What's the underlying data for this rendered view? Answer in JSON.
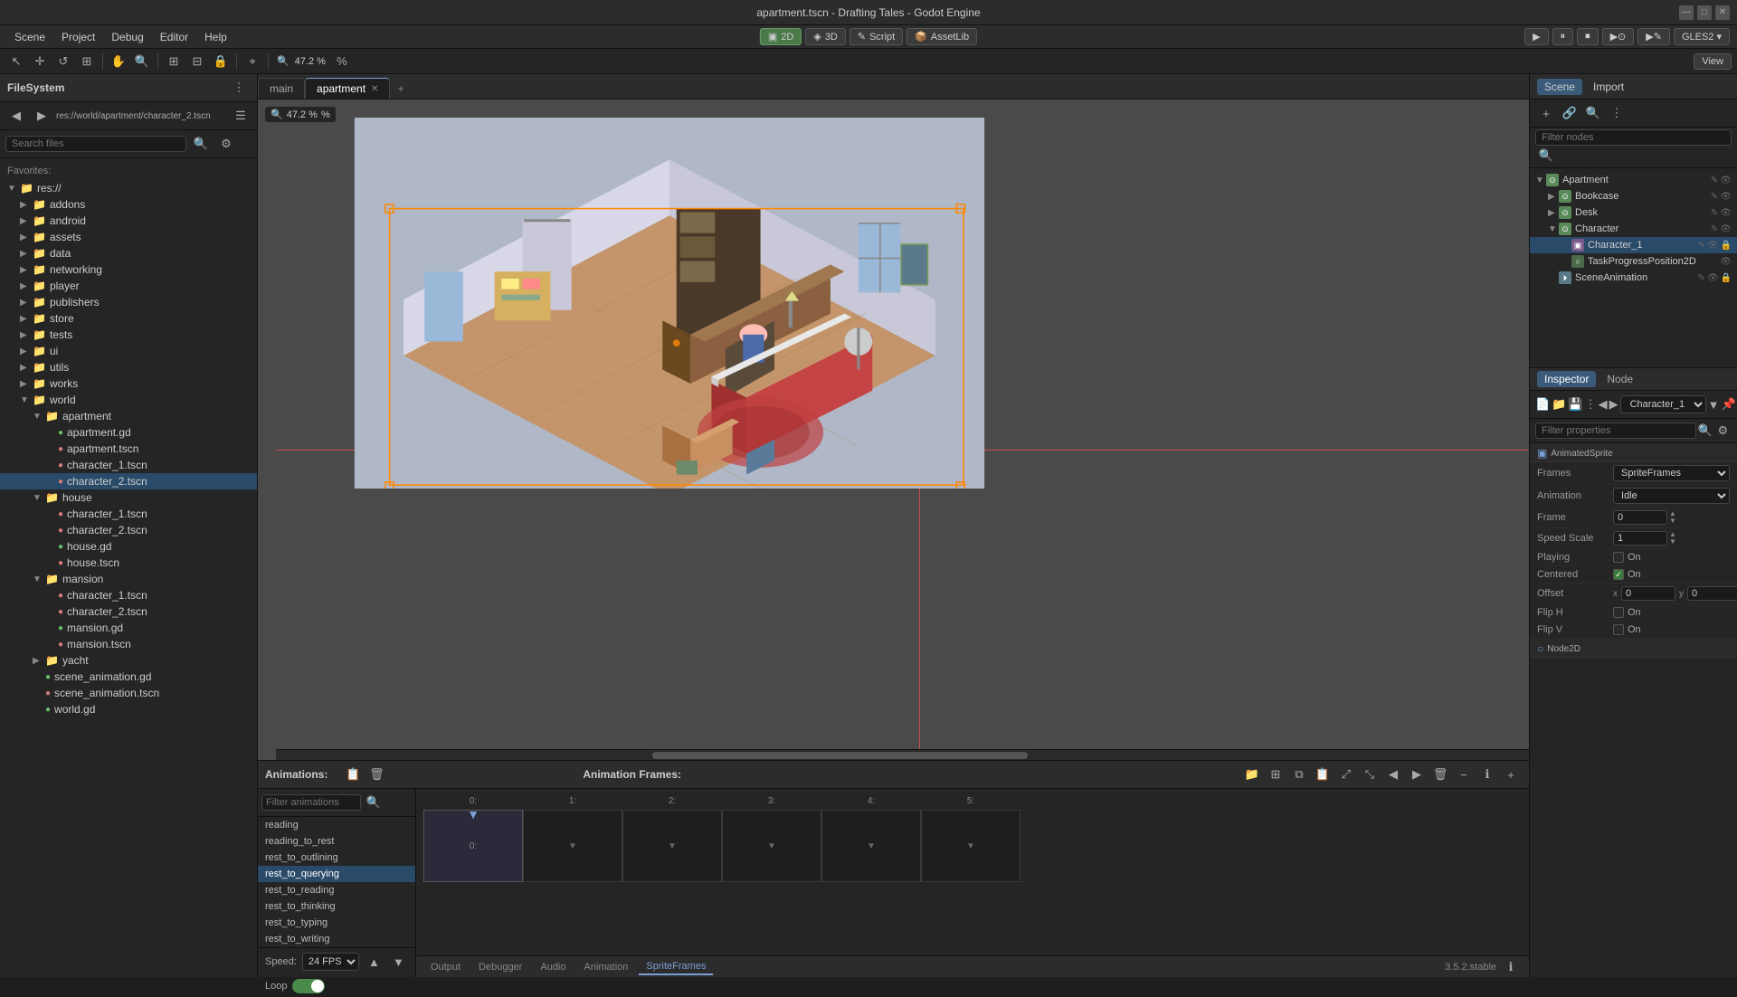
{
  "titlebar": {
    "title": "apartment.tscn - Drafting Tales - Godot Engine",
    "minimize": "—",
    "maximize": "□",
    "close": "✕"
  },
  "menubar": {
    "items": [
      "Scene",
      "Project",
      "Debug",
      "Editor",
      "Help"
    ],
    "toolbar": {
      "btn2d": "2D",
      "btn3d": "3D",
      "btnScript": "Script",
      "btnAssetLib": "AssetLib"
    },
    "gles": "GLES2 ▾"
  },
  "toolbar2": {
    "zoom": "47.2 %",
    "view": "View"
  },
  "filesystem": {
    "title": "FileSystem",
    "search_placeholder": "Search files",
    "favorites": "Favorites:",
    "tree": [
      {
        "indent": 0,
        "type": "dir",
        "label": "res://",
        "expanded": true
      },
      {
        "indent": 1,
        "type": "dir",
        "label": "addons",
        "expanded": false
      },
      {
        "indent": 1,
        "type": "dir",
        "label": "android",
        "expanded": false
      },
      {
        "indent": 1,
        "type": "dir",
        "label": "assets",
        "expanded": false
      },
      {
        "indent": 1,
        "type": "dir",
        "label": "data",
        "expanded": false
      },
      {
        "indent": 1,
        "type": "dir",
        "label": "networking",
        "expanded": false
      },
      {
        "indent": 1,
        "type": "dir",
        "label": "player",
        "expanded": false
      },
      {
        "indent": 1,
        "type": "dir",
        "label": "publishers",
        "expanded": false
      },
      {
        "indent": 1,
        "type": "dir",
        "label": "store",
        "expanded": false
      },
      {
        "indent": 1,
        "type": "dir",
        "label": "tests",
        "expanded": false
      },
      {
        "indent": 1,
        "type": "dir",
        "label": "ui",
        "expanded": false
      },
      {
        "indent": 1,
        "type": "dir",
        "label": "utils",
        "expanded": false
      },
      {
        "indent": 1,
        "type": "dir",
        "label": "works",
        "expanded": false
      },
      {
        "indent": 1,
        "type": "dir",
        "label": "world",
        "expanded": true
      },
      {
        "indent": 2,
        "type": "dir",
        "label": "apartment",
        "expanded": true
      },
      {
        "indent": 3,
        "type": "file",
        "ext": "gd",
        "label": "apartment.gd"
      },
      {
        "indent": 3,
        "type": "file",
        "ext": "tscn",
        "label": "apartment.tscn"
      },
      {
        "indent": 3,
        "type": "file",
        "ext": "tscn",
        "label": "character_1.tscn"
      },
      {
        "indent": 3,
        "type": "file",
        "ext": "tscn",
        "label": "character_2.tscn",
        "selected": true
      },
      {
        "indent": 2,
        "type": "dir",
        "label": "house",
        "expanded": true
      },
      {
        "indent": 3,
        "type": "file",
        "ext": "tscn",
        "label": "character_1.tscn"
      },
      {
        "indent": 3,
        "type": "file",
        "ext": "tscn",
        "label": "character_2.tscn"
      },
      {
        "indent": 3,
        "type": "file",
        "ext": "gd",
        "label": "house.gd"
      },
      {
        "indent": 3,
        "type": "file",
        "ext": "tscn",
        "label": "house.tscn"
      },
      {
        "indent": 2,
        "type": "dir",
        "label": "mansion",
        "expanded": true
      },
      {
        "indent": 3,
        "type": "file",
        "ext": "tscn",
        "label": "character_1.tscn"
      },
      {
        "indent": 3,
        "type": "file",
        "ext": "tscn",
        "label": "character_2.tscn"
      },
      {
        "indent": 3,
        "type": "file",
        "ext": "gd",
        "label": "mansion.gd"
      },
      {
        "indent": 3,
        "type": "file",
        "ext": "tscn",
        "label": "mansion.tscn"
      },
      {
        "indent": 2,
        "type": "dir",
        "label": "yacht",
        "expanded": false
      },
      {
        "indent": 2,
        "type": "file",
        "ext": "gd",
        "label": "scene_animation.gd"
      },
      {
        "indent": 2,
        "type": "file",
        "ext": "tscn",
        "label": "scene_animation.tscn"
      },
      {
        "indent": 2,
        "type": "file",
        "ext": "gd",
        "label": "world.gd"
      }
    ]
  },
  "tabs": {
    "items": [
      "main",
      "apartment"
    ],
    "active": "apartment",
    "add": "+"
  },
  "viewport": {
    "zoom": "47.2 %"
  },
  "scene_panel": {
    "tabs": [
      "Scene",
      "Import"
    ],
    "active": "Scene",
    "filter_placeholder": "Filter nodes",
    "nodes": [
      {
        "indent": 0,
        "type": "scene2d",
        "label": "Apartment",
        "expanded": true
      },
      {
        "indent": 1,
        "type": "scene2d",
        "label": "Bookcase",
        "expanded": false
      },
      {
        "indent": 1,
        "type": "scene2d",
        "label": "Desk",
        "expanded": false
      },
      {
        "indent": 1,
        "type": "scene2d",
        "label": "Character",
        "expanded": true
      },
      {
        "indent": 2,
        "type": "sprite",
        "label": "Character_1",
        "selected": true
      },
      {
        "indent": 2,
        "type": "node2d",
        "label": "TaskProgressPosition2D"
      },
      {
        "indent": 1,
        "type": "anim",
        "label": "SceneAnimation"
      }
    ]
  },
  "inspector": {
    "tabs": [
      "Inspector",
      "Node"
    ],
    "active": "Inspector",
    "node_name": "Character_1",
    "comp_label": "AnimatedSprite",
    "search_placeholder": "Filter properties",
    "props": [
      {
        "label": "Frames",
        "type": "select",
        "value": "SpriteFrames"
      },
      {
        "label": "Animation",
        "type": "select",
        "value": "Idle"
      },
      {
        "label": "Frame",
        "type": "number",
        "value": "0"
      },
      {
        "label": "Speed Scale",
        "type": "number",
        "value": "1"
      },
      {
        "label": "Playing",
        "type": "toggle",
        "value": "On",
        "checked": false
      },
      {
        "label": "Centered",
        "type": "toggle",
        "value": "On",
        "checked": true
      },
      {
        "label": "Offset",
        "type": "xy",
        "x": "0",
        "y": "0"
      },
      {
        "label": "Flip H",
        "type": "toggle",
        "value": "On",
        "checked": false
      },
      {
        "label": "Flip V",
        "type": "toggle",
        "value": "On",
        "checked": false
      },
      {
        "label": "Node2D",
        "type": "section"
      }
    ]
  },
  "animations": {
    "label": "Animations:",
    "frames_label": "Animation Frames:",
    "list": [
      "reading",
      "reading_to_rest",
      "rest_to_outlining",
      "rest_to_querying",
      "rest_to_reading",
      "rest_to_thinking",
      "rest_to_typing",
      "rest_to_writing"
    ],
    "selected": "rest_to_querying",
    "speed_label": "Speed:",
    "speed_value": "24 FPS",
    "loop_label": "Loop",
    "frame_numbers": [
      "0:",
      "1:",
      "2:",
      "3:",
      "4:",
      "5:"
    ]
  },
  "bottom_tabs": [
    "Output",
    "Debugger",
    "Audio",
    "Animation",
    "SpriteFrames"
  ],
  "bottom_active": "SpriteFrames",
  "status": "3.5.2.stable",
  "colors": {
    "accent": "#7a9fd4",
    "selected_bg": "#2a4a6a",
    "active_tab_border": "#7a9fd4",
    "folder_color": "#d4ac6e",
    "gd_color": "#6abf6a",
    "tscn_color": "#d47a7a"
  }
}
